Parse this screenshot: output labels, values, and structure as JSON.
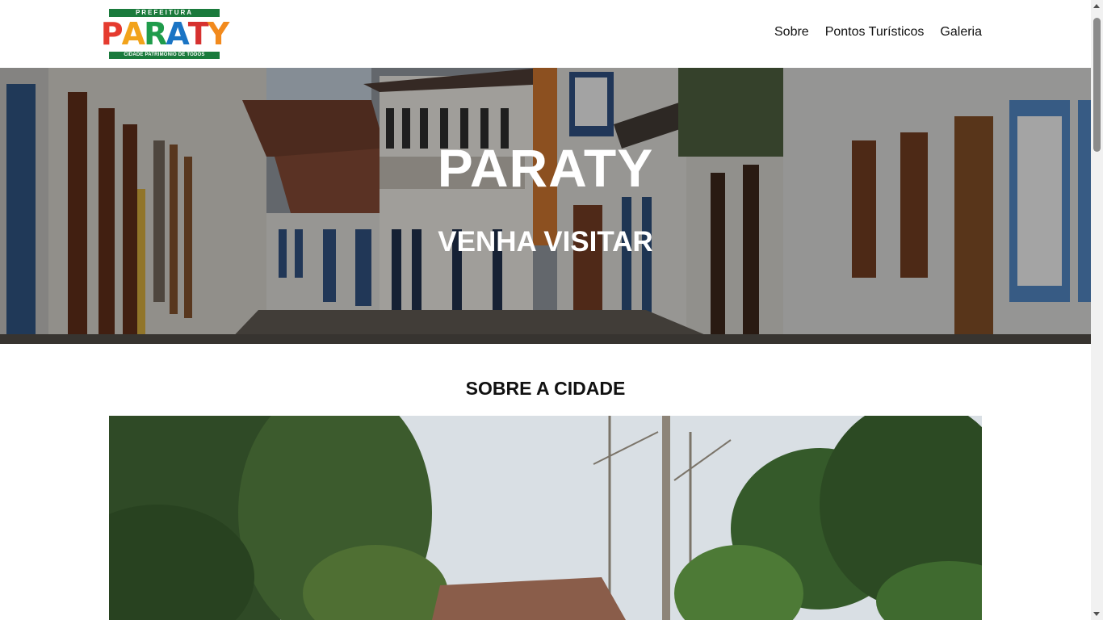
{
  "header": {
    "logo": {
      "top_text": "PREFEITURA",
      "letters": [
        {
          "char": "P",
          "color": "#e53b2f"
        },
        {
          "char": "A",
          "color": "#f2a31b"
        },
        {
          "char": "R",
          "color": "#1f9b4b"
        },
        {
          "char": "A",
          "color": "#1a74c4"
        },
        {
          "char": "T",
          "color": "#d6312f"
        },
        {
          "char": "Y",
          "color": "#f28a1d"
        }
      ],
      "bottom_text": "CIDADE PATRIMÔNIO DE TODOS",
      "band_color": "#1a7a3c"
    },
    "nav": [
      {
        "label": "Sobre"
      },
      {
        "label": "Pontos Turísticos"
      },
      {
        "label": "Galeria"
      }
    ]
  },
  "hero": {
    "title": "PARATY",
    "subtitle": "VENHA VISITAR",
    "image": "colonial-street-photo"
  },
  "about": {
    "title": "SOBRE A CIDADE",
    "image": "tropical-garden-photo"
  },
  "scrollbar": {
    "up_icon": "scroll-up-arrow-icon",
    "down_icon": "scroll-down-arrow-icon"
  }
}
